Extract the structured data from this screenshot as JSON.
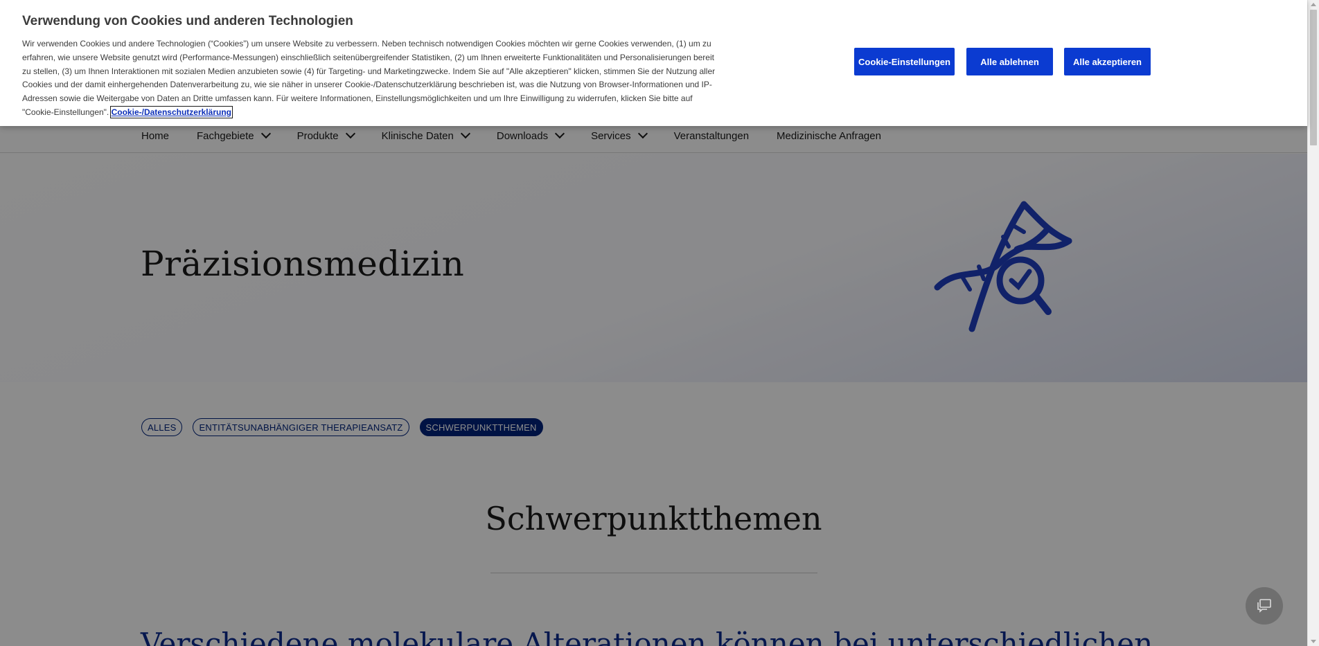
{
  "cookie_banner": {
    "title": "Verwendung von Cookies und anderen Technologien",
    "text": "Wir verwenden Cookies und andere Technologien (“Cookies”) um unsere Website zu verbessern. Neben technisch notwendigen Cookies möchten wir gerne Cookies verwenden, (1) um zu erfahren, wie unsere Website genutzt wird (Performance-Messungen) einschließlich seitenübergreifender Statistiken, (2) um Ihnen erweiterte Funktionalitäten und Personalisierungen bereit zu stellen, (3) um Ihnen Interaktionen mit sozialen Medien anzubieten sowie (4) für Targeting- und Marketingzwecke. Indem Sie auf \"Alle akzeptieren\" klicken, stimmen Sie der Nutzung aller Cookies und der damit einhergehenden Datenverarbeitung zu, wie sie näher in unserer Cookie-/Datenschutzerklärung beschrieben ist, was die Nutzung von Browser-Informationen und IP-Adressen sowie die Weitergabe von Daten an Dritte umfassen kann. Für weitere Informationen, Einstellungsmöglichkeiten und um Ihre Einwilligung zu widerrufen, klicken Sie bitte auf \"Cookie-Einstellungen\".",
    "policy_link": "Cookie-/Datenschutzerklärung",
    "buttons": {
      "settings": "Cookie-Einstellungen",
      "reject": "Alle ablehnen",
      "accept": "Alle akzeptieren"
    },
    "button_color": "#0b3bd1"
  },
  "nav": {
    "items": [
      {
        "label": "Home",
        "has_dropdown": false
      },
      {
        "label": "Fachgebiete",
        "has_dropdown": true
      },
      {
        "label": "Produkte",
        "has_dropdown": true
      },
      {
        "label": "Klinische Daten",
        "has_dropdown": true
      },
      {
        "label": "Downloads",
        "has_dropdown": true
      },
      {
        "label": "Services",
        "has_dropdown": true
      },
      {
        "label": "Veranstaltungen",
        "has_dropdown": false
      },
      {
        "label": "Medizinische Anfragen",
        "has_dropdown": false
      }
    ]
  },
  "hero": {
    "title": "Präzisionsmedizin",
    "icon": "dna-magnifier-icon",
    "icon_color": "#1f3fbf"
  },
  "filters": {
    "items": [
      {
        "label": "ALLES",
        "active": false
      },
      {
        "label": "ENTITÄTSUNABHÄNGIGER THERAPIEANSATZ",
        "active": false
      },
      {
        "label": "SCHWERPUNKTTHEMEN",
        "active": true
      }
    ],
    "accent_color": "#00247d"
  },
  "section": {
    "title": "Schwerpunktthemen",
    "intro": "Verschiedene molekulare Alterationen können bei unterschiedlichen"
  },
  "chat": {
    "icon": "chat-icon"
  }
}
